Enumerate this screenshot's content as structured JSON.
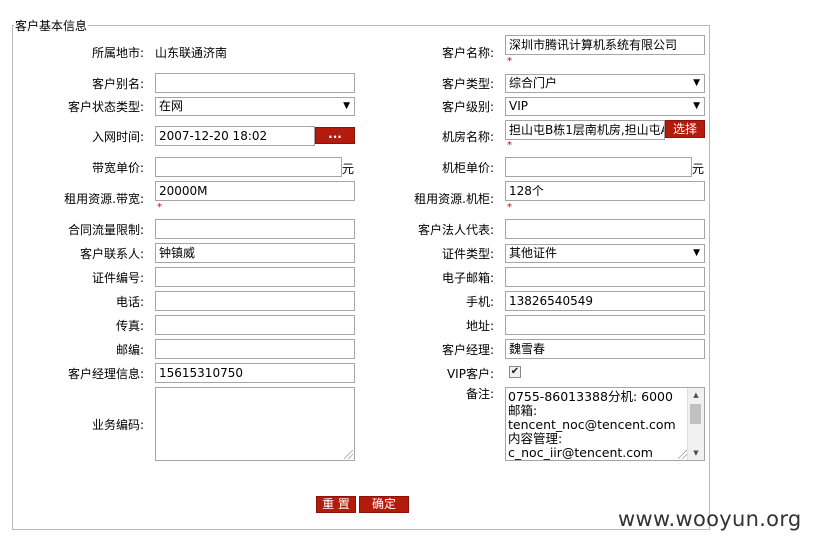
{
  "fieldset_title": "客户基本信息",
  "fields": {
    "region_label": "所属地市:",
    "region_value": "山东联通济南",
    "customer_name_label": "客户名称:",
    "customer_name_value": "深圳市腾讯计算机系统有限公司",
    "alias_label": "客户别名:",
    "alias_value": "",
    "customer_type_label": "客户类型:",
    "customer_type_value": "综合门户",
    "status_type_label": "客户状态类型:",
    "status_type_value": "在网",
    "customer_level_label": "客户级别:",
    "customer_level_value": "VIP",
    "join_time_label": "入网时间:",
    "join_time_value": "2007-12-20 18:02",
    "date_button_label": "...",
    "room_name_label": "机房名称:",
    "room_name_value": "担山屯B栋1层南机房,担山屯A",
    "room_select_button_label": "选择",
    "bandwidth_price_label": "带宽单价:",
    "bandwidth_price_value": "",
    "bandwidth_unit": "元",
    "cabinet_price_label": "机柜单价:",
    "cabinet_price_value": "",
    "cabinet_unit": "元",
    "rent_bandwidth_label": "租用资源.带宽:",
    "rent_bandwidth_value": "20000M",
    "rent_cabinet_label": "租用资源.机柜:",
    "rent_cabinet_value": "128个",
    "traffic_limit_label": "合同流量限制:",
    "traffic_limit_value": "",
    "legal_rep_label": "客户法人代表:",
    "legal_rep_value": "",
    "contact_label": "客户联系人:",
    "contact_value": "钟镇威",
    "id_type_label": "证件类型:",
    "id_type_value": "其他证件",
    "id_number_label": "证件编号:",
    "id_number_value": "",
    "email_label": "电子邮箱:",
    "email_value": "",
    "phone_label": "电话:",
    "phone_value": "",
    "mobile_label": "手机:",
    "mobile_value": "13826540549",
    "fax_label": "传真:",
    "fax_value": "",
    "address_label": "地址:",
    "address_value": "",
    "postcode_label": "邮编:",
    "postcode_value": "",
    "manager_label": "客户经理:",
    "manager_value": "魏雪春",
    "manager_info_label": "客户经理信息:",
    "manager_info_value": "15615310750",
    "vip_label": "VIP客户:",
    "vip_checked": true,
    "remarks_label": "备注:",
    "remarks_lines": [
      "0755-86013388分机: 6000",
      "邮箱:",
      "tencent_noc@tencent.com",
      "内容管理:",
      "c_noc_iir@tencent.com"
    ],
    "business_code_label": "业务编码:",
    "business_code_value": ""
  },
  "required_mark": "*",
  "buttons": {
    "reset": "重 置",
    "confirm": "确定"
  },
  "watermark": "www.wooyun.org",
  "colors": {
    "button_red": "#b31b0c",
    "required_red": "#e00000",
    "border": "#a5a5a5"
  }
}
